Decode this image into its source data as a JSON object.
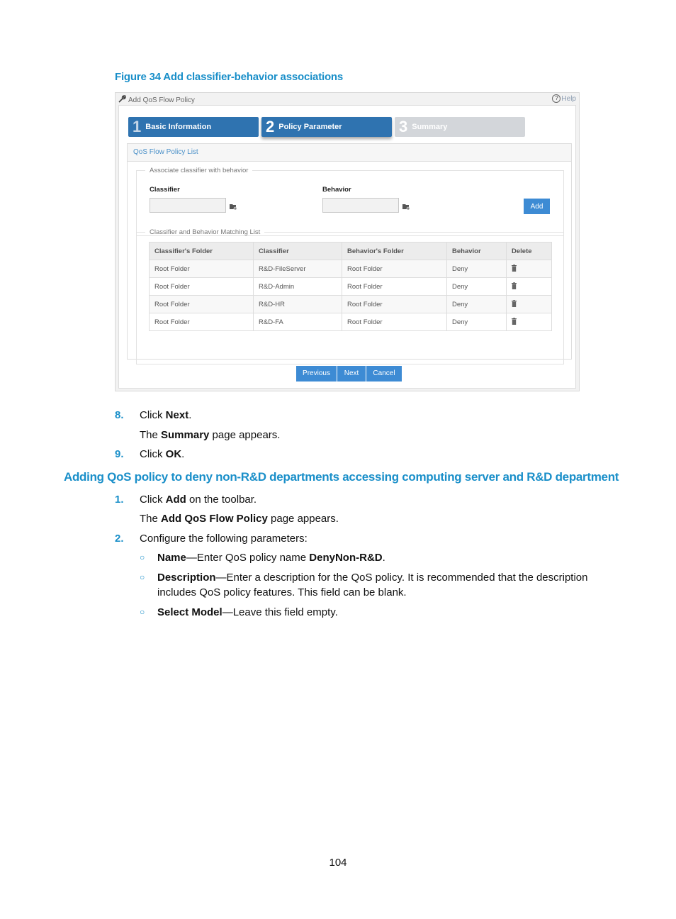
{
  "figure": {
    "caption": "Figure 34 Add classifier-behavior associations",
    "window_title": "Add QoS Flow Policy",
    "help_label": "Help",
    "steps": [
      {
        "num": "1",
        "label": "Basic Information",
        "state": "completed"
      },
      {
        "num": "2",
        "label": "Policy Parameter",
        "state": "active"
      },
      {
        "num": "3",
        "label": "Summary",
        "state": "pending"
      }
    ],
    "policy_list_link": "QoS Flow Policy List",
    "associate_group": {
      "legend": "Associate classifier with behavior",
      "classifier_label": "Classifier",
      "classifier_value": "",
      "behavior_label": "Behavior",
      "behavior_value": "",
      "add_button": "Add"
    },
    "matching_list": {
      "legend": "Classifier and Behavior Matching List",
      "columns": [
        "Classifier's Folder",
        "Classifier",
        "Behavior's Folder",
        "Behavior",
        "Delete"
      ],
      "rows": [
        [
          "Root Folder",
          "R&D-FileServer",
          "Root Folder",
          "Deny"
        ],
        [
          "Root Folder",
          "R&D-Admin",
          "Root Folder",
          "Deny"
        ],
        [
          "Root Folder",
          "R&D-HR",
          "Root Folder",
          "Deny"
        ],
        [
          "Root Folder",
          "R&D-FA",
          "Root Folder",
          "Deny"
        ]
      ]
    },
    "buttons": {
      "previous": "Previous",
      "next": "Next",
      "cancel": "Cancel"
    }
  },
  "steps_part1": [
    {
      "num": "8.",
      "pre": "Click ",
      "bold": "Next",
      "post": "."
    },
    {
      "sub_pre": "The ",
      "sub_bold": "Summary",
      "sub_post": " page appears."
    },
    {
      "num": "9.",
      "pre": "Click ",
      "bold": "OK",
      "post": "."
    }
  ],
  "section_heading": "Adding QoS policy to deny non-R&D departments accessing computing server and R&D department",
  "steps_part2": [
    {
      "num": "1.",
      "pre": "Click ",
      "bold": "Add",
      "post": " on the toolbar."
    },
    {
      "sub_pre": "The ",
      "sub_bold": "Add QoS Flow Policy",
      "sub_post": " page appears."
    },
    {
      "num": "2.",
      "text": "Configure the following parameters:"
    }
  ],
  "bullets": [
    {
      "bold": "Name",
      "text": "—Enter QoS policy name ",
      "bold2": "DenyNon-R&D",
      "post": "."
    },
    {
      "bold": "Description",
      "text": "—Enter a description for the QoS policy. It is recommended that the description",
      "line2": "includes QoS policy features. This field can be blank."
    },
    {
      "bold": "Select Model",
      "text": "—Leave this field empty."
    }
  ],
  "page_number": "104"
}
